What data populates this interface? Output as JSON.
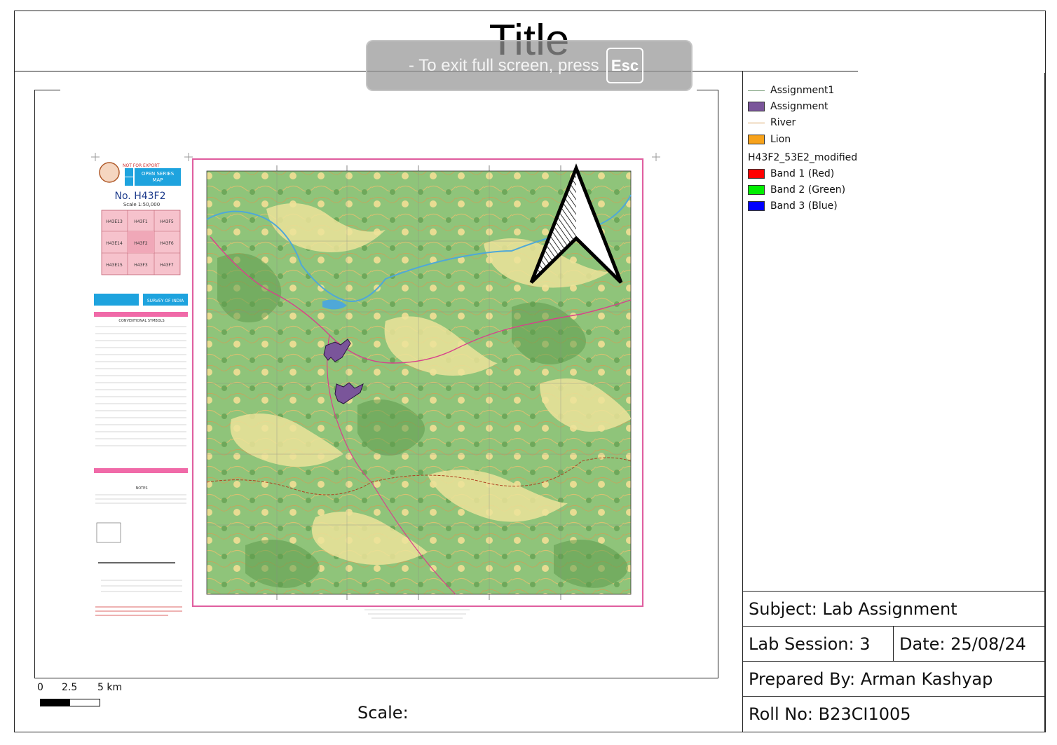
{
  "title": "Title",
  "fullscreen_notice": {
    "text": "-  To exit full screen, press",
    "key": "Esc"
  },
  "legend": {
    "items": [
      {
        "label": "Assignment1",
        "kind": "line",
        "color": "#7a9e7a"
      },
      {
        "label": "Assignment",
        "kind": "patch",
        "color": "#7a559a"
      },
      {
        "label": "River",
        "kind": "line",
        "color": "#d6a05a"
      },
      {
        "label": "Lion",
        "kind": "patch",
        "color": "#f7a21b"
      }
    ],
    "raster_group": "H43F2_53E2_modified",
    "bands": [
      {
        "label": "Band 1 (Red)",
        "color": "#ff0000"
      },
      {
        "label": "Band 2 (Green)",
        "color": "#00ee00"
      },
      {
        "label": "Band 3 (Blue)",
        "color": "#0000ff"
      }
    ]
  },
  "info": {
    "subject": "Subject: Lab Assignment",
    "session": "Lab Session: 3",
    "date": "Date: 25/08/24",
    "prepared_by": "Prepared By: Arman Kashyap",
    "roll_no": "Roll No: B23CI1005"
  },
  "scale": {
    "label": "Scale:",
    "ticks": [
      "0",
      "2.5",
      "5 km"
    ]
  },
  "map_sheet": {
    "export_note": "NOT FOR EXPORT",
    "series": "OPEN SERIES MAP",
    "sheet_no": "No. H43F2",
    "scale_text": "Scale 1:50,000",
    "index": [
      "H43E13",
      "H43F1",
      "H43F5",
      "H43E14",
      "H43F2",
      "H43F6",
      "H43E15",
      "H43F3",
      "H43F7"
    ],
    "agency": "SURVEY OF INDIA",
    "symbols_heading": "CONVENTIONAL SYMBOLS",
    "notes_heading": "NOTES"
  },
  "colors": {
    "terrain_base": "#8fc47a",
    "terrain_light": "#e8dc92",
    "forest_dark": "#5e9a4c",
    "neatline": "#e060a0",
    "aoi": "#7a559a",
    "road": "#d8408c",
    "water": "#4fa8d8"
  }
}
